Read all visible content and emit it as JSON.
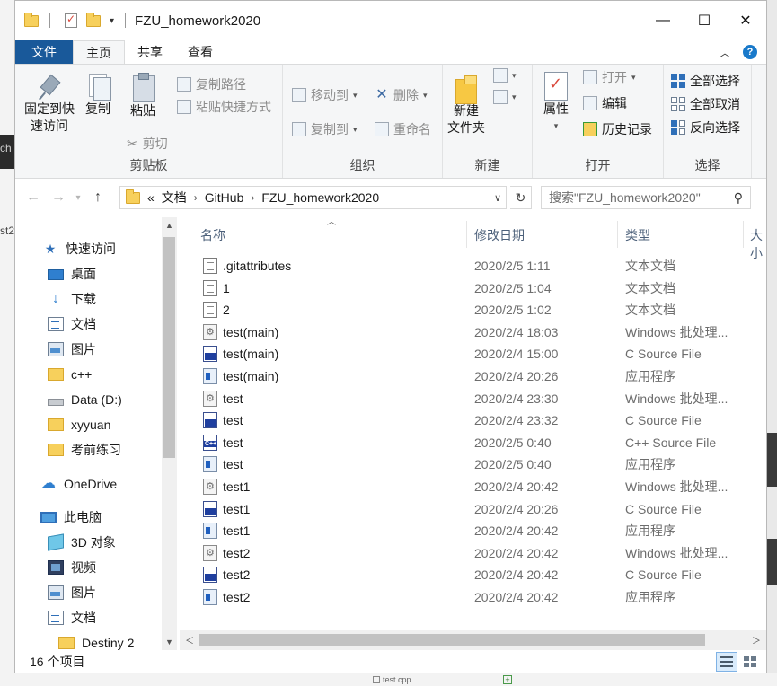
{
  "window": {
    "title": "FZU_homework2020",
    "controls": {
      "minimize": "—",
      "maximize": "☐",
      "close": "✕"
    }
  },
  "ribbon_tabs": {
    "file": "文件",
    "home": "主页",
    "share": "共享",
    "view": "查看"
  },
  "ribbon": {
    "clipboard": {
      "label": "剪贴板",
      "pin_quick_access": "固定到快\n速访问",
      "copy": "复制",
      "paste": "粘贴",
      "copy_path": "复制路径",
      "paste_shortcut": "粘贴快捷方式",
      "cut": "剪切"
    },
    "organize": {
      "label": "组织",
      "move_to": "移动到",
      "copy_to": "复制到",
      "delete": "删除",
      "rename": "重命名"
    },
    "new": {
      "label": "新建",
      "new_folder": "新建\n文件夹"
    },
    "open": {
      "label": "打开",
      "properties": "属性",
      "open": "打开",
      "edit": "编辑",
      "history": "历史记录"
    },
    "select": {
      "label": "选择",
      "select_all": "全部选择",
      "select_none": "全部取消",
      "invert": "反向选择"
    }
  },
  "address": {
    "prefix": "«",
    "crumbs": [
      "文档",
      "GitHub",
      "FZU_homework2020"
    ],
    "search_placeholder": "搜索\"FZU_homework2020\""
  },
  "nav": {
    "quick_access": "快速访问",
    "items": [
      {
        "label": "桌面",
        "icon": "desktop-icon",
        "pinned": true
      },
      {
        "label": "下载",
        "icon": "download-icon",
        "pinned": true
      },
      {
        "label": "文档",
        "icon": "documents-icon",
        "pinned": true
      },
      {
        "label": "图片",
        "icon": "pictures-icon",
        "pinned": true
      },
      {
        "label": "c++",
        "icon": "folder-icon"
      },
      {
        "label": "Data (D:)",
        "icon": "drive-icon"
      },
      {
        "label": "xyyuan",
        "icon": "folder-icon"
      },
      {
        "label": "考前练习",
        "icon": "folder-icon"
      }
    ],
    "onedrive": "OneDrive",
    "this_pc": "此电脑",
    "pc_items": [
      {
        "label": "3D 对象",
        "icon": "3d-objects-icon"
      },
      {
        "label": "视频",
        "icon": "videos-icon"
      },
      {
        "label": "图片",
        "icon": "pictures-icon"
      },
      {
        "label": "文档",
        "icon": "documents-icon"
      },
      {
        "label": "Destiny 2",
        "icon": "folder-icon"
      }
    ]
  },
  "columns": {
    "name": "名称",
    "date": "修改日期",
    "type": "类型",
    "size": "大小"
  },
  "files": [
    {
      "name": ".gitattributes",
      "date": "2020/2/5 1:11",
      "type": "文本文档",
      "kind": "txt"
    },
    {
      "name": "1",
      "date": "2020/2/5 1:04",
      "type": "文本文档",
      "kind": "txt"
    },
    {
      "name": "2",
      "date": "2020/2/5 1:02",
      "type": "文本文档",
      "kind": "txt"
    },
    {
      "name": "test(main)",
      "date": "2020/2/4 18:03",
      "type": "Windows 批处理...",
      "kind": "bat"
    },
    {
      "name": "test(main)",
      "date": "2020/2/4 15:00",
      "type": "C Source File",
      "kind": "c"
    },
    {
      "name": "test(main)",
      "date": "2020/2/4 20:26",
      "type": "应用程序",
      "kind": "exe"
    },
    {
      "name": "test",
      "date": "2020/2/4 23:30",
      "type": "Windows 批处理...",
      "kind": "bat"
    },
    {
      "name": "test",
      "date": "2020/2/4 23:32",
      "type": "C Source File",
      "kind": "c"
    },
    {
      "name": "test",
      "date": "2020/2/5 0:40",
      "type": "C++ Source File",
      "kind": "cpp"
    },
    {
      "name": "test",
      "date": "2020/2/5 0:40",
      "type": "应用程序",
      "kind": "exe"
    },
    {
      "name": "test1",
      "date": "2020/2/4 20:42",
      "type": "Windows 批处理...",
      "kind": "bat"
    },
    {
      "name": "test1",
      "date": "2020/2/4 20:26",
      "type": "C Source File",
      "kind": "c"
    },
    {
      "name": "test1",
      "date": "2020/2/4 20:42",
      "type": "应用程序",
      "kind": "exe"
    },
    {
      "name": "test2",
      "date": "2020/2/4 20:42",
      "type": "Windows 批处理...",
      "kind": "bat"
    },
    {
      "name": "test2",
      "date": "2020/2/4 20:42",
      "type": "C Source File",
      "kind": "c"
    },
    {
      "name": "test2",
      "date": "2020/2/4 20:42",
      "type": "应用程序",
      "kind": "exe"
    }
  ],
  "status": {
    "item_count": "16 个项目"
  },
  "background": {
    "left_text_1": "ch",
    "left_text_2": "st2",
    "bottom_file": "test.cpp"
  },
  "colors": {
    "file_tab": "#19599a",
    "accent": "#2f6fb8",
    "folder": "#f7d05c"
  }
}
